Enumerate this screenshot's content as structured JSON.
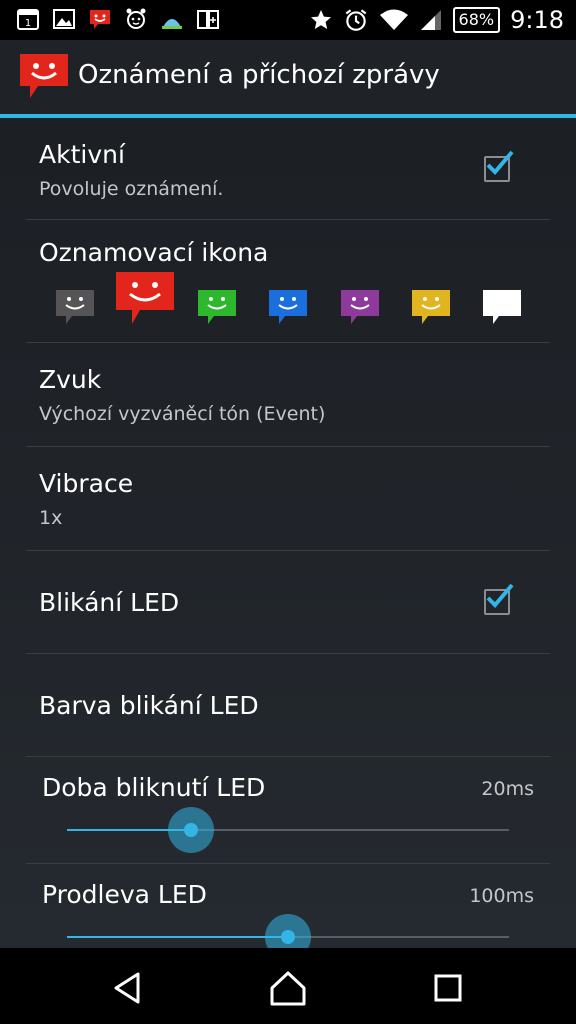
{
  "status_bar": {
    "calendar_day": "1",
    "battery": "68%",
    "time": "9:18",
    "icons": [
      "calendar-icon",
      "gallery-icon",
      "sms-notification-icon",
      "alarm-app-icon",
      "weather-icon",
      "book-icon",
      "star-icon",
      "alarm-icon",
      "wifi-icon",
      "signal-icon"
    ]
  },
  "action_bar": {
    "title": "Oznámení a příchozí zprávy",
    "icon": "red-smiley-bubble-icon"
  },
  "preferences": {
    "active": {
      "title": "Aktivní",
      "summary": "Povoluje oznámení.",
      "checked": true
    },
    "notif_icon": {
      "title": "Oznamovací ikona",
      "colors": [
        "#555555",
        "#e3261c",
        "#2eb82e",
        "#1a6fdc",
        "#8e3a9a",
        "#e0b520",
        "#ffffff"
      ],
      "selected_index": 1
    },
    "sound": {
      "title": "Zvuk",
      "summary": "Výchozí vyzváněcí tón (Event)"
    },
    "vibration": {
      "title": "Vibrace",
      "summary": "1x"
    },
    "led_blink": {
      "title": "Blikání LED",
      "checked": true
    },
    "led_color": {
      "title": "Barva blikání LED"
    },
    "blink_duration": {
      "title": "Doba bliknutí LED",
      "value": "20ms",
      "fraction": 0.28
    },
    "blink_delay": {
      "title": "Prodleva LED",
      "value": "100ms",
      "fraction": 0.5
    }
  },
  "accent_color": "#33b5e5",
  "nav_bar": [
    "back-icon",
    "home-icon",
    "recents-icon"
  ]
}
